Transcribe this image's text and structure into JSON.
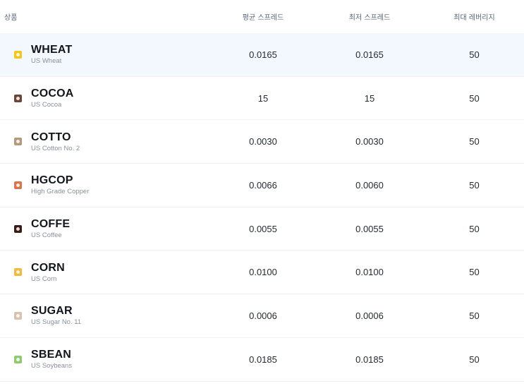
{
  "header": {
    "product": "상품",
    "avg_spread": "평균 스프레드",
    "min_spread": "최저 스프레드",
    "max_leverage": "최대 레버리지"
  },
  "rows": [
    {
      "symbol": "WHEAT",
      "name": "US Wheat",
      "avg": "0.0165",
      "min": "0.0165",
      "lev": "50",
      "icon": "wheat-icon",
      "color": "#f5c518"
    },
    {
      "symbol": "COCOA",
      "name": "US Cocoa",
      "avg": "15",
      "min": "15",
      "lev": "50",
      "icon": "cocoa-icon",
      "color": "#6b4636"
    },
    {
      "symbol": "COTTO",
      "name": "US Cotton No. 2",
      "avg": "0.0030",
      "min": "0.0030",
      "lev": "50",
      "icon": "cotton-icon",
      "color": "#b39a78"
    },
    {
      "symbol": "HGCOP",
      "name": "High Grade Copper",
      "avg": "0.0066",
      "min": "0.0060",
      "lev": "50",
      "icon": "copper-icon",
      "color": "#d9774a"
    },
    {
      "symbol": "COFFE",
      "name": "US Coffee",
      "avg": "0.0055",
      "min": "0.0055",
      "lev": "50",
      "icon": "coffee-icon",
      "color": "#3a1b16"
    },
    {
      "symbol": "CORN",
      "name": "US Corn",
      "avg": "0.0100",
      "min": "0.0100",
      "lev": "50",
      "icon": "corn-icon",
      "color": "#f6b93b"
    },
    {
      "symbol": "SUGAR",
      "name": "US Sugar No. 11",
      "avg": "0.0006",
      "min": "0.0006",
      "lev": "50",
      "icon": "sugar-icon",
      "color": "#d8c3b0"
    },
    {
      "symbol": "SBEAN",
      "name": "US Soybeans",
      "avg": "0.0185",
      "min": "0.0185",
      "lev": "50",
      "icon": "soybean-icon",
      "color": "#8fcb6e"
    }
  ],
  "highlight_color": "#f3f8fe"
}
